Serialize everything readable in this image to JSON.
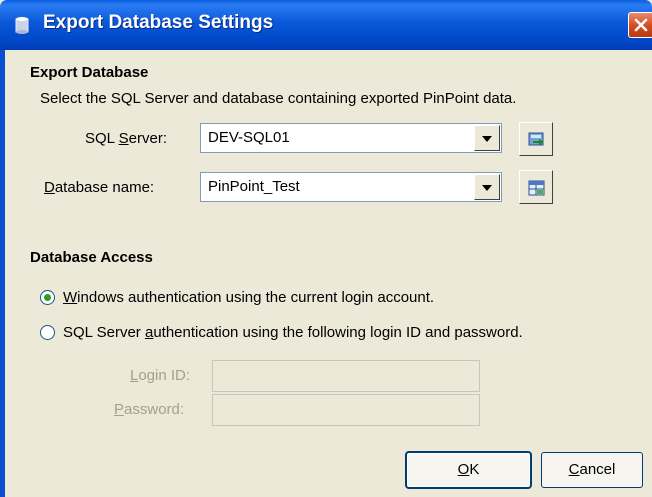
{
  "window": {
    "title": "Export Database Settings"
  },
  "export_section": {
    "heading": "Export Database",
    "description": "Select the SQL Server and database containing exported PinPoint data.",
    "sql_server": {
      "label_pre": "SQL ",
      "label_ul": "S",
      "label_post": "erver:",
      "value": "DEV-SQL01"
    },
    "database": {
      "label_ul": "D",
      "label_post": "atabase name:",
      "value": "PinPoint_Test"
    }
  },
  "access_section": {
    "heading": "Database Access",
    "options": [
      {
        "ul": "W",
        "rest": "indows authentication using the current login account.",
        "checked": true
      },
      {
        "pre": "SQL Server ",
        "ul": "a",
        "rest": "uthentication using the following login ID and password.",
        "checked": false
      }
    ],
    "login_id": {
      "ul": "L",
      "rest": "ogin ID:",
      "value": ""
    },
    "password": {
      "ul": "P",
      "rest": "assword:",
      "value": ""
    }
  },
  "buttons": {
    "ok": {
      "ul": "O",
      "rest": "K"
    },
    "cancel": {
      "ul": "C",
      "rest": "ancel"
    }
  },
  "colors": {
    "titlebar": "#0a58d8",
    "face": "#ece9d8",
    "close": "#d14b1f",
    "radio_dot": "#2b9a2b"
  },
  "icons": [
    "database-icon",
    "close-icon",
    "browse-servers-icon",
    "browse-databases-icon",
    "dropdown-arrow-icon"
  ]
}
